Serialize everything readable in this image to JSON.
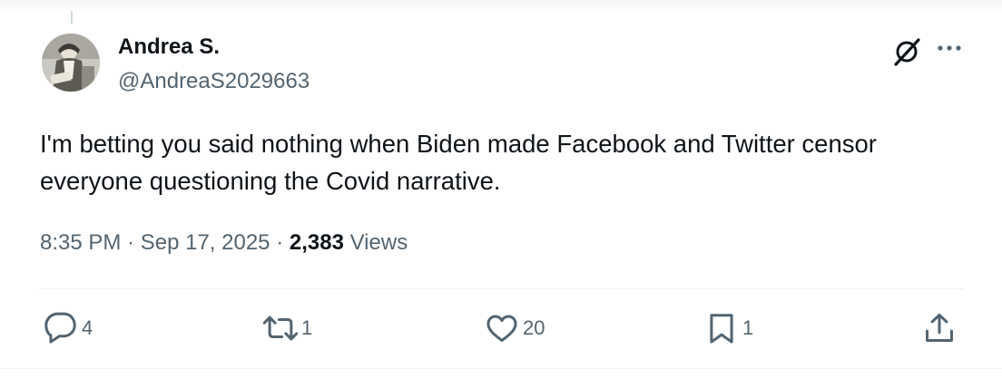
{
  "post": {
    "author_name": "Andrea S.",
    "author_handle": "@AndreaS2029663",
    "text": "I'm betting you said nothing when Biden made Facebook and Twitter censor everyone questioning the Covid narrative.",
    "time": "8:35 PM",
    "date": "Sep 17, 2025",
    "views_count": "2,383",
    "views_label": "Views",
    "separator": "·"
  },
  "actions": {
    "replies": "4",
    "reposts": "1",
    "likes": "20",
    "bookmarks": "1"
  },
  "icons": {
    "header": [
      "grok-icon",
      "more-icon"
    ],
    "actions": [
      "reply-icon",
      "repost-icon",
      "like-icon",
      "bookmark-icon",
      "share-icon"
    ]
  },
  "colors": {
    "text_primary": "#0f1419",
    "text_secondary": "#536471",
    "divider": "#eff3f4"
  }
}
